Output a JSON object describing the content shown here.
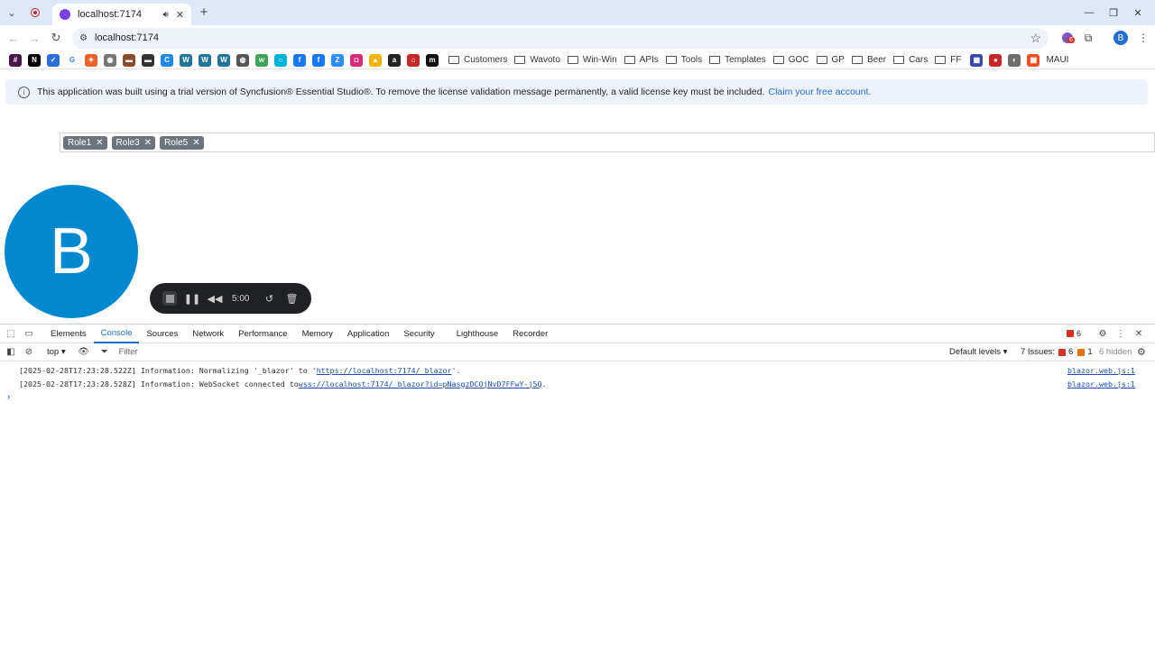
{
  "browser": {
    "tab_title": "localhost:7174",
    "url": "localhost:7174",
    "profile_initial": "B",
    "extension_badge": "6"
  },
  "bookmarks": {
    "icons": [
      {
        "name": "slack-icon",
        "color": "#4a154b",
        "glyph": "#"
      },
      {
        "name": "notion-icon",
        "color": "#000000",
        "glyph": "N"
      },
      {
        "name": "app-icon-1",
        "color": "#2b6fd6",
        "glyph": "✓"
      },
      {
        "name": "google-icon",
        "color": "#ffffff",
        "glyph": "G"
      },
      {
        "name": "app-icon-2",
        "color": "#e8632b",
        "glyph": "✦"
      },
      {
        "name": "app-icon-3",
        "color": "#777777",
        "glyph": "◉"
      },
      {
        "name": "car-icon-1",
        "color": "#8a4b2a",
        "glyph": "▬"
      },
      {
        "name": "car-icon-2",
        "color": "#333333",
        "glyph": "▬"
      },
      {
        "name": "app-icon-4",
        "color": "#1e88e5",
        "glyph": "C"
      },
      {
        "name": "wordpress-icon-1",
        "color": "#21759b",
        "glyph": "W"
      },
      {
        "name": "wordpress-icon-2",
        "color": "#21759b",
        "glyph": "W"
      },
      {
        "name": "wordpress-icon-3",
        "color": "#21759b",
        "glyph": "W"
      },
      {
        "name": "globe-icon",
        "color": "#555555",
        "glyph": "◍"
      },
      {
        "name": "app-icon-5",
        "color": "#3aa757",
        "glyph": "w"
      },
      {
        "name": "app-icon-6",
        "color": "#00b4d8",
        "glyph": "○"
      },
      {
        "name": "facebook-icon-1",
        "color": "#1877f2",
        "glyph": "f"
      },
      {
        "name": "facebook-icon-2",
        "color": "#1877f2",
        "glyph": "f"
      },
      {
        "name": "zoom-icon",
        "color": "#2d8cff",
        "glyph": "Z"
      },
      {
        "name": "instagram-icon",
        "color": "#d62976",
        "glyph": "◘"
      },
      {
        "name": "app-icon-7",
        "color": "#f4b400",
        "glyph": "▲"
      },
      {
        "name": "amazon-icon",
        "color": "#222222",
        "glyph": "a"
      },
      {
        "name": "app-icon-8",
        "color": "#c62828",
        "glyph": "⌂"
      },
      {
        "name": "app-icon-9",
        "color": "#111111",
        "glyph": "m"
      }
    ],
    "folders_a": [
      "Customers",
      "Wavoto",
      "Win-Win",
      "APIs",
      "Tools",
      "Templates",
      "GOC",
      "GP",
      "Beer",
      "Cars",
      "FF"
    ],
    "tail_icons": [
      {
        "name": "app-icon-10",
        "color": "#3949ab",
        "glyph": "▦"
      },
      {
        "name": "app-icon-11",
        "color": "#c62828",
        "glyph": "●"
      },
      {
        "name": "app-icon-12",
        "color": "#6d6d6d",
        "glyph": "◐"
      },
      {
        "name": "microsoft-icon",
        "color": "#f25022",
        "glyph": "▦"
      }
    ],
    "folder_last": "MAUI"
  },
  "banner": {
    "text": "This application was built using a trial version of Syncfusion® Essential Studio®. To remove the license validation message permanently, a valid license key must be included.",
    "link": "Claim your free account."
  },
  "chips": [
    "Role1",
    "Role3",
    "Role5"
  ],
  "avatar": {
    "initial": "B",
    "color": "#0288d1"
  },
  "recorder": {
    "time": "5:00"
  },
  "devtools": {
    "tabs": [
      "Elements",
      "Console",
      "Sources",
      "Network",
      "Performance",
      "Memory",
      "Application",
      "Security",
      "Lighthouse",
      "Recorder"
    ],
    "active_tab": "Console",
    "error_count": "6",
    "context": "top ▾",
    "filter_placeholder": "Filter",
    "levels": "Default levels ▾",
    "issues_label": "7 Issues:",
    "issues_errors": "6",
    "issues_warnings": "1",
    "hidden": "6 hidden",
    "logs": [
      {
        "prefix": "[2025-02-28T17:23:28.522Z] Information: Normalizing '_blazor' to '",
        "link": "https://localhost:7174/_blazor",
        "suffix": "'.",
        "source": "blazor.web.js:1"
      },
      {
        "prefix": "[2025-02-28T17:23:28.528Z] Information: WebSocket connected to ",
        "link": "wss://localhost:7174/_blazor?id=pNasgzDCOjNvD7FFwY-j5Q",
        "suffix": ".",
        "source": "blazor.web.js:1"
      }
    ]
  }
}
